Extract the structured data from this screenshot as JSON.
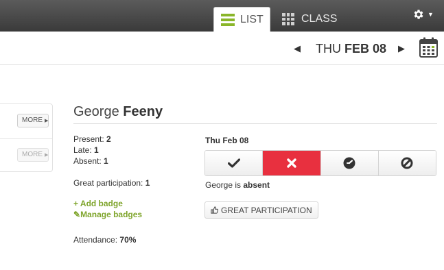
{
  "header": {
    "tabs": [
      {
        "label": "LIST",
        "icon": "list-icon",
        "active": true
      },
      {
        "label": "CLASS",
        "icon": "grid-icon",
        "active": false
      }
    ],
    "settings_icon": "gear-icon"
  },
  "date_nav": {
    "prev_icon": "triangle-left-icon",
    "weekday": "THU",
    "date": "FEB 08",
    "next_icon": "triangle-right-icon",
    "calendar_icon": "calendar-icon"
  },
  "student_list": {
    "more_labels": [
      "MORE",
      "MORE"
    ]
  },
  "student": {
    "first_name": "George",
    "last_name": "Feeny",
    "present_label": "Present:",
    "present_value": "2",
    "late_label": "Late:",
    "late_value": "1",
    "absent_label": "Absent:",
    "absent_value": "1",
    "participation_label": "Great participation:",
    "participation_value": "1",
    "add_badge": "+ Add badge",
    "manage_badges": "Manage badges",
    "attendance_label": "Attendance:",
    "attendance_value": "70%"
  },
  "attendance": {
    "date_label": "Thu Feb 08",
    "buttons": [
      {
        "icon": "check-icon",
        "state": "present"
      },
      {
        "icon": "x-icon",
        "state": "absent",
        "active": true
      },
      {
        "icon": "clock-icon",
        "state": "late"
      },
      {
        "icon": "excused-icon",
        "state": "excused"
      }
    ],
    "status_prefix": "George is",
    "status_value": "absent",
    "badge_button": "GREAT PARTICIPATION",
    "badge_icon": "thumbs-up-icon"
  },
  "colors": {
    "accent_green": "#8ab62a",
    "absent_red": "#e8303f",
    "topbar": "#4a4a4a"
  }
}
